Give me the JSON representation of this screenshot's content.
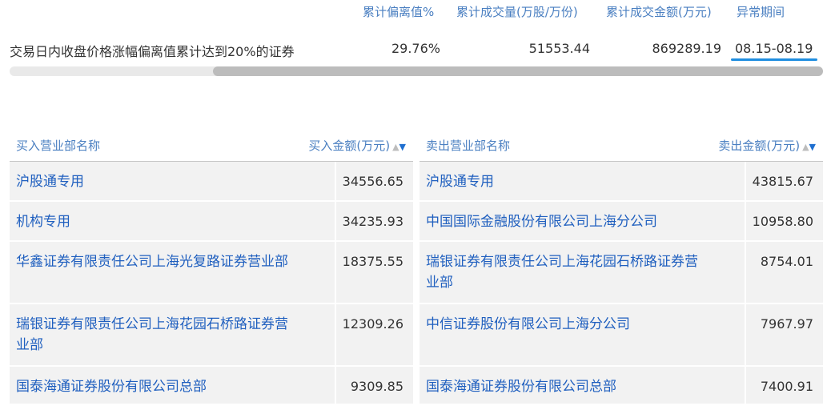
{
  "summary": {
    "headers": {
      "deviation": "累计偏离值%",
      "volume": "累计成交量(万股/万份)",
      "amount": "累计成交金额(万元)",
      "period": "异常期间"
    },
    "row": {
      "type": "交易日内收盘价格涨幅偏离值累计达到20%的证券",
      "deviation": "29.76%",
      "volume": "51553.44",
      "amount": "869289.19",
      "period": "08.15-08.19"
    }
  },
  "buy": {
    "header_name": "买入营业部名称",
    "header_amount": "买入金额(万元)",
    "rows": [
      {
        "name": "沪股通专用",
        "amount": "34556.65"
      },
      {
        "name": "机构专用",
        "amount": "34235.93"
      },
      {
        "name": "华鑫证券有限责任公司上海光复路证券营业部",
        "amount": "18375.55"
      },
      {
        "name": "瑞银证券有限责任公司上海花园石桥路证券营业部",
        "amount": "12309.26"
      },
      {
        "name": "国泰海通证券股份有限公司总部",
        "amount": "9309.85"
      }
    ]
  },
  "sell": {
    "header_name": "卖出营业部名称",
    "header_amount": "卖出金额(万元)",
    "rows": [
      {
        "name": "沪股通专用",
        "amount": "43815.67"
      },
      {
        "name": "中国国际金融股份有限公司上海分公司",
        "amount": "10958.80"
      },
      {
        "name": "瑞银证券有限责任公司上海花园石桥路证券营业部",
        "amount": "8754.01"
      },
      {
        "name": "中信证券股份有限公司上海分公司",
        "amount": "7967.97"
      },
      {
        "name": "国泰海通证券股份有限公司总部",
        "amount": "7400.91"
      }
    ]
  },
  "icons": {
    "sort_up": "▲",
    "sort_down": "▼"
  }
}
